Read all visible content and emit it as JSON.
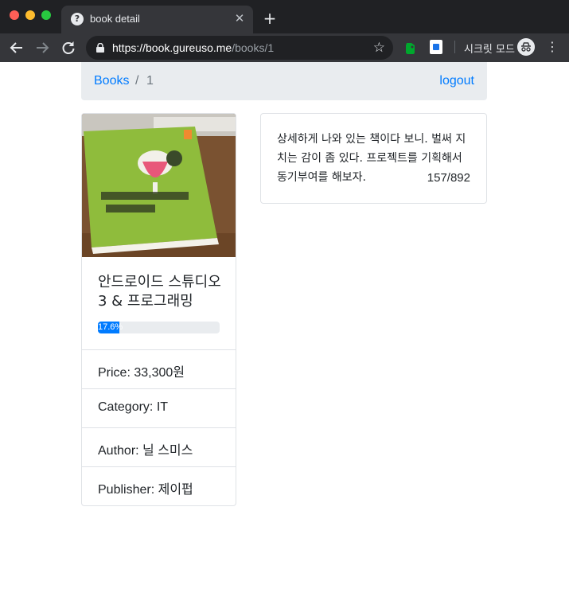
{
  "browser": {
    "tab_title": "book detail",
    "url_host": "https://book.gureuso.me",
    "url_path": "/books/1",
    "incognito_label": "시크릿 모드"
  },
  "navbar": {
    "breadcrumb_home": "Books",
    "breadcrumb_separator": "/",
    "breadcrumb_current": "1",
    "logout_label": "logout"
  },
  "book": {
    "title": "안드로이드 스튜디오 3 & 프로그래밍",
    "progress_percent": 17.6,
    "progress_label": "17.6%",
    "details": [
      "Price: 33,300원",
      "Category: IT",
      "Author: 닐 스미스",
      "Publisher: 제이펍"
    ]
  },
  "memo": {
    "text": "상세하게 나와 있는 책이다 보니. 벌써 지치는 감이 좀 있다. 프로젝트를 기획해서 동기부여를 해보자.",
    "page": "157/892"
  },
  "colors": {
    "link": "#007bff",
    "progress": "#007bff",
    "navbar_bg": "#e9ecef"
  }
}
